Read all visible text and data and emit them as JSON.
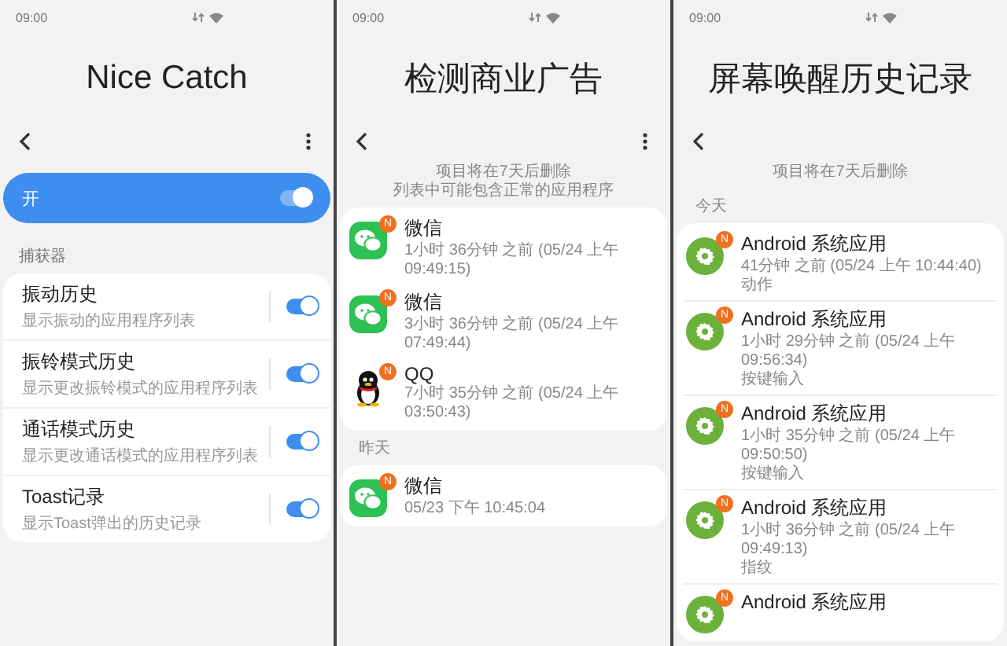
{
  "panels": [
    {
      "kind": "settings",
      "status_bar": {
        "time": "09:00"
      },
      "title": "Nice Catch",
      "menu": true,
      "master_switch": {
        "label": "开",
        "on": true
      },
      "section_label": "捕获器",
      "settings": [
        {
          "title": "振动历史",
          "subtitle": "显示振动的应用程序列表",
          "on": true
        },
        {
          "title": "振铃模式历史",
          "subtitle": "显示更改振铃模式的应用程序列表",
          "on": true
        },
        {
          "title": "通话模式历史",
          "subtitle": "显示更改通话模式的应用程序列表",
          "on": true
        },
        {
          "title": "Toast记录",
          "subtitle": "显示Toast弹出的历史记录",
          "on": true
        }
      ]
    },
    {
      "kind": "history",
      "status_bar": {
        "time": "09:00"
      },
      "title": "检测商业广告",
      "menu": true,
      "notices": [
        "项目将在7天后删除",
        "列表中可能包含正常的应用程序"
      ],
      "groups": [
        {
          "items": [
            {
              "kind": "wechat",
              "badge": "N",
              "name": "微信",
              "time": "1小时 36分钟 之前 (05/24 上午 09:49:15)"
            },
            {
              "kind": "wechat",
              "badge": "N",
              "name": "微信",
              "time": "3小时 36分钟 之前 (05/24 上午 07:49:44)"
            },
            {
              "kind": "qq",
              "badge": "N",
              "name": "QQ",
              "time": "7小时 35分钟 之前 (05/24 上午 03:50:43)"
            }
          ]
        },
        {
          "header": "昨天",
          "items": [
            {
              "kind": "wechat",
              "badge": "N",
              "name": "微信",
              "time": "05/23 下午 10:45:04"
            }
          ]
        }
      ]
    },
    {
      "kind": "history",
      "status_bar": {
        "time": "09:00"
      },
      "title": "屏幕唤醒历史记录",
      "menu": false,
      "notices": [
        "项目将在7天后删除"
      ],
      "groups": [
        {
          "header": "今天",
          "divided": true,
          "items": [
            {
              "kind": "android",
              "badge": "N",
              "name": "Android 系统应用",
              "time": "41分钟 之前 (05/24 上午 10:44:40)",
              "detail": "动作"
            },
            {
              "kind": "android",
              "badge": "N",
              "name": "Android 系统应用",
              "time": "1小时 29分钟 之前 (05/24 上午 09:56:34)",
              "detail": "按键输入"
            },
            {
              "kind": "android",
              "badge": "N",
              "name": "Android 系统应用",
              "time": "1小时 35分钟 之前 (05/24 上午 09:50:50)",
              "detail": "按键输入"
            },
            {
              "kind": "android",
              "badge": "N",
              "name": "Android 系统应用",
              "time": "1小时 36分钟 之前 (05/24 上午 09:49:13)",
              "detail": "指纹"
            },
            {
              "kind": "android",
              "badge": "N",
              "name": "Android 系统应用"
            }
          ]
        }
      ]
    }
  ]
}
